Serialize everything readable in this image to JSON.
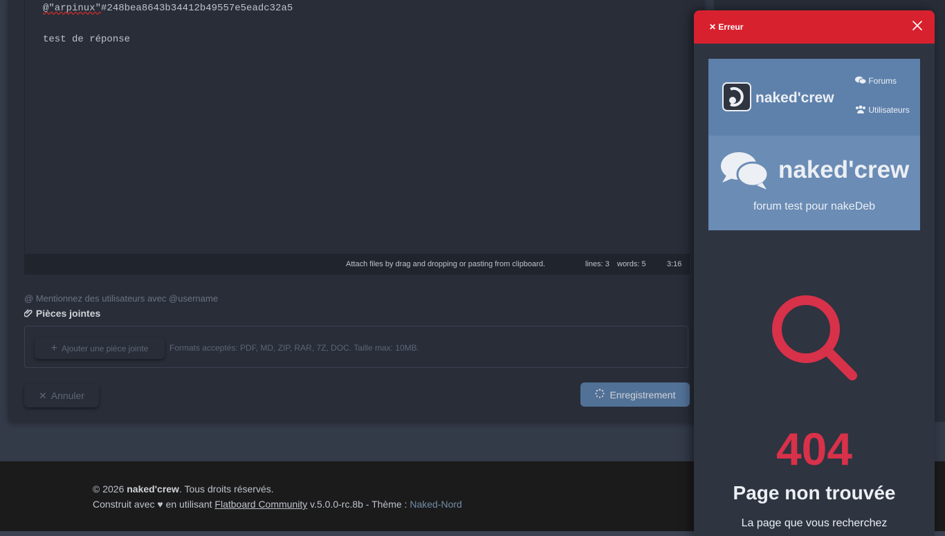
{
  "editor": {
    "lines": [
      {
        "mention": "@\"arpinux\"",
        "hash": "#248bea8643b34412b49557e5eadc32a5"
      },
      {
        "text": "test de réponse"
      }
    ],
    "status": {
      "attach_hint": "Attach files by drag and dropping or pasting from clipboard.",
      "lines": "lines: 3",
      "words": "words: 5",
      "cursor": "3:16"
    }
  },
  "mention_hint": "Mentionnez des utilisateurs avec @username",
  "attachments": {
    "title": "Pièces jointes",
    "add_button": "Ajouter une pièce jointe",
    "formats": "Formats acceptés: PDF, MD, ZIP, RAR, 7Z, DOC. Taille max: 10MB."
  },
  "buttons": {
    "cancel": "Annuler",
    "save": "Enregistrement"
  },
  "footer": {
    "year": "© 2026",
    "site": "naked'crew",
    "rights": ". Tous droits réservés.",
    "built_with": "Construit avec ♥ en utilisant",
    "engine_link": "Flatboard Community",
    "version": "v.5.0.0-rc.8b - Thème :",
    "theme_link": "Naked-Nord"
  },
  "modal": {
    "title": "✕ Erreur",
    "screenshot": {
      "brand": "naked'crew",
      "nav": [
        "Forums",
        "Utilisateurs"
      ],
      "hero_title": "naked'crew",
      "hero_subtitle": "forum test pour nakeDeb"
    },
    "error_code": "404",
    "error_title": "Page non trouvée",
    "error_text": "La page que vous recherchez"
  },
  "colors": {
    "accent": "#5e81ac",
    "danger": "#d8212f",
    "error_icon": "#d8314a"
  }
}
